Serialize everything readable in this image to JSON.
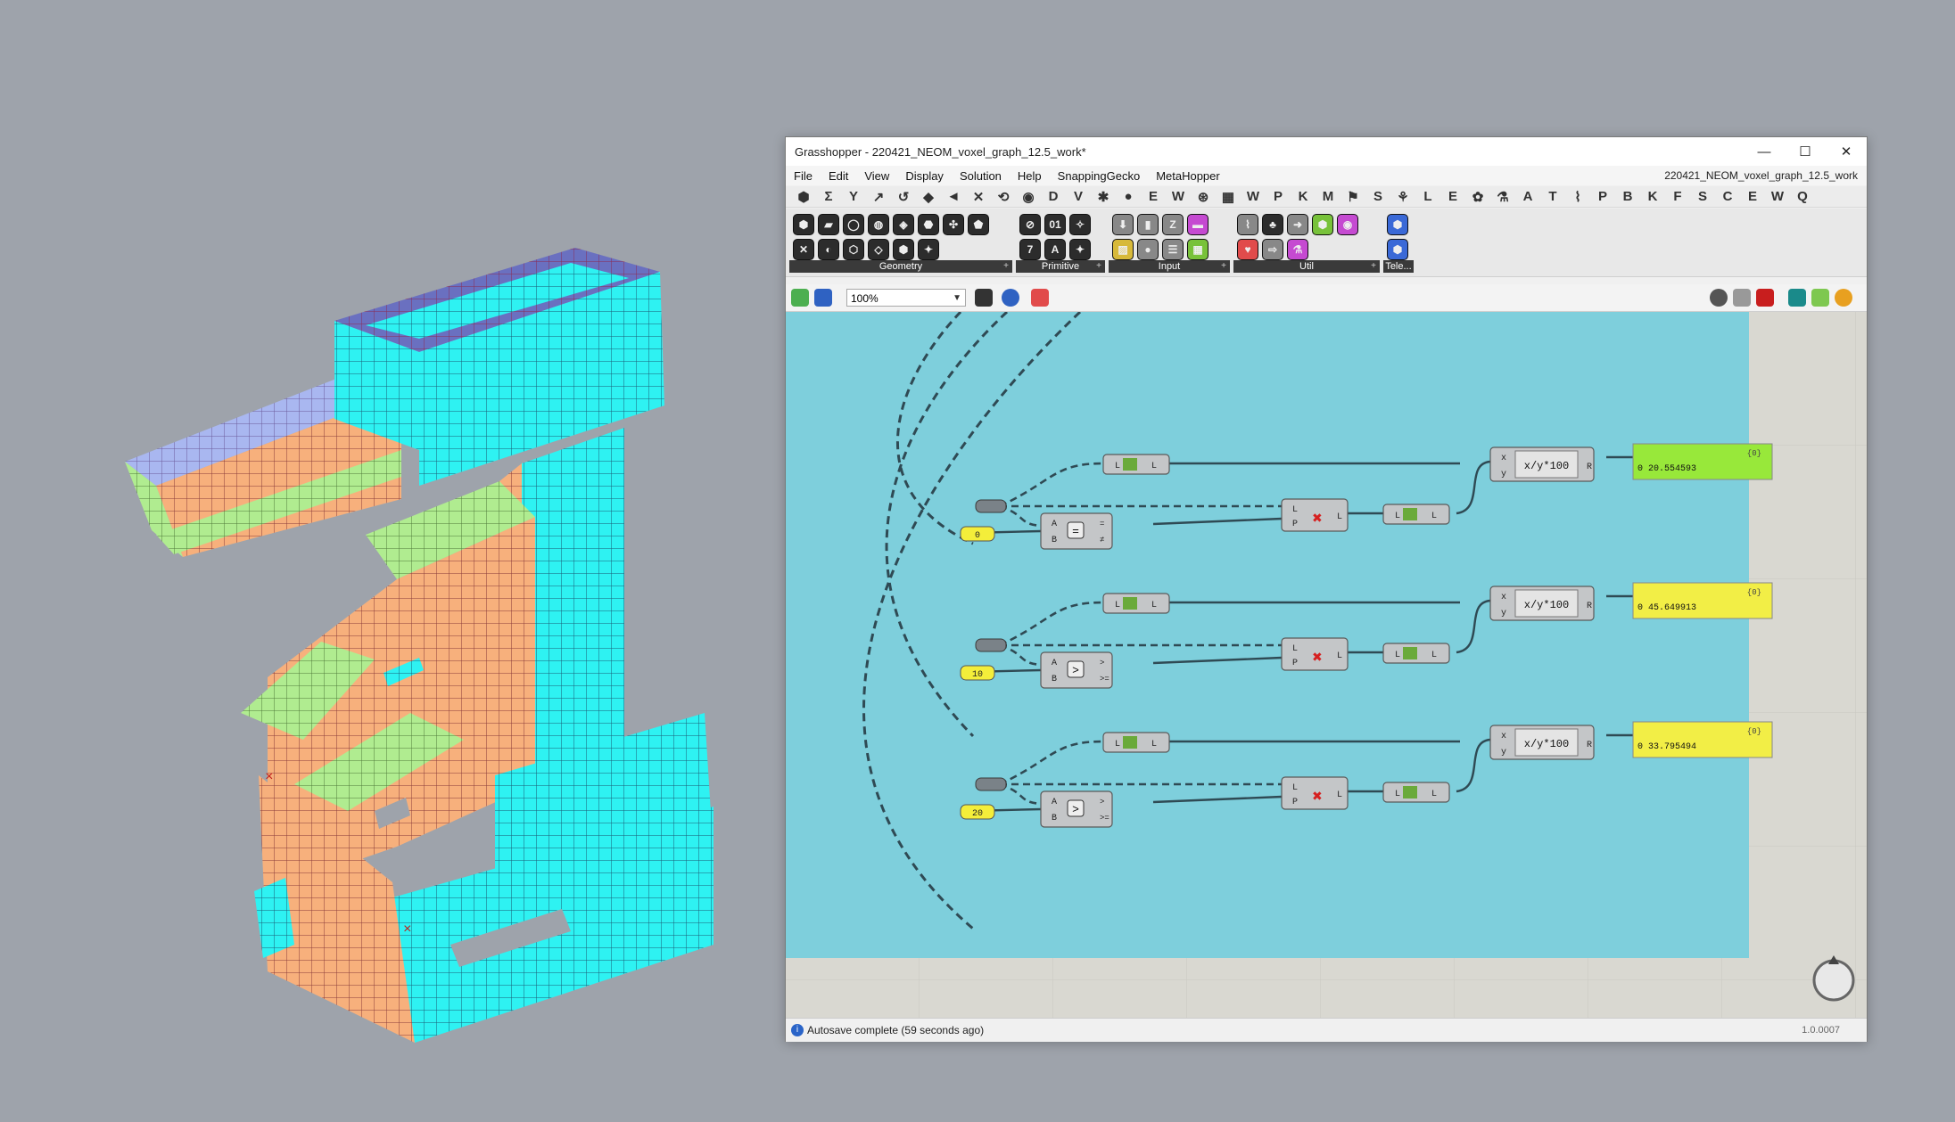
{
  "window": {
    "title": "Grasshopper - 220421_NEOM_voxel_graph_12.5_work*",
    "doc_name": "220421_NEOM_voxel_graph_12.5_work",
    "buttons": {
      "minimize": "—",
      "maximize": "☐",
      "close": "✕"
    }
  },
  "menu": [
    "File",
    "Edit",
    "View",
    "Display",
    "Solution",
    "Help",
    "SnappingGecko",
    "MetaHopper"
  ],
  "tabs": [
    "⬢",
    "Σ",
    "Y",
    "↗",
    "↺",
    "◆",
    "◄",
    "✕",
    "⟲",
    "◉",
    "D",
    "V",
    "✱",
    "●",
    "E",
    "W",
    "⊛",
    "▦",
    "W",
    "P",
    "K",
    "M",
    "⚑",
    "S",
    "⚘",
    "L",
    "E",
    "✿",
    "⚗",
    "A",
    "T",
    "⌇",
    "P",
    "B",
    "K",
    "F",
    "S",
    "C",
    "E",
    "W",
    "Q"
  ],
  "ribbon_groups": [
    {
      "label": "Geometry"
    },
    {
      "label": "Primitive"
    },
    {
      "label": "Input"
    },
    {
      "label": "Util"
    },
    {
      "label": "Tele..."
    }
  ],
  "toolbar": {
    "zoom": "100%"
  },
  "graph": {
    "rows": [
      {
        "input": "0",
        "op_symbol": "=",
        "op_out1": "=",
        "op_out2": "≠",
        "expression": "x/y*100",
        "panel_header": "{0}",
        "panel_value": "0 20.554593",
        "panel_color": "#98e83a"
      },
      {
        "input": "10",
        "op_symbol": ">",
        "op_out1": ">",
        "op_out2": ">=",
        "expression": "x/y*100",
        "panel_header": "{0}",
        "panel_value": "0 45.649913",
        "panel_color": "#f2ee46"
      },
      {
        "input": "20",
        "op_symbol": ">",
        "op_out1": ">",
        "op_out2": ">=",
        "expression": "x/y*100",
        "panel_header": "{0}",
        "panel_value": "0 33.795494",
        "panel_color": "#f2ee46"
      }
    ]
  },
  "status": {
    "message": "Autosave complete (59 seconds ago)",
    "version": "1.0.0007"
  }
}
